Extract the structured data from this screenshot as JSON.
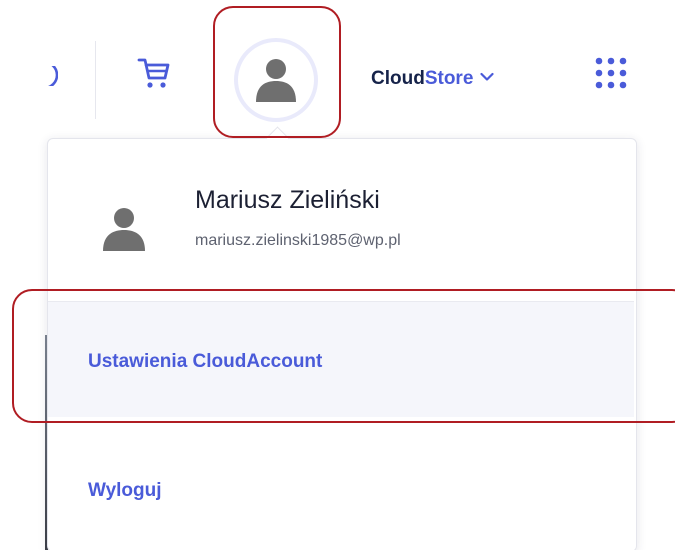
{
  "header": {
    "brand_prefix": "Cloud",
    "brand_suffix": "Store",
    "icons": {
      "partial": "search-icon",
      "cart": "cart-icon",
      "avatar": "user-avatar-icon",
      "brand_chevron": "chevron-down-icon",
      "apps": "apps-grid-icon"
    }
  },
  "user_menu": {
    "name": "Mariusz Zieliński",
    "email": "mariusz.zielinski1985@wp.pl",
    "items": [
      {
        "label": "Ustawienia CloudAccount"
      },
      {
        "label": "Wyloguj"
      }
    ]
  },
  "colors": {
    "accent": "#4a5bd9",
    "brand_dark": "#16234a",
    "highlight": "#b01d23",
    "icon_gray": "#6f6f6f",
    "menu_hover_bg": "#f5f6fb"
  }
}
